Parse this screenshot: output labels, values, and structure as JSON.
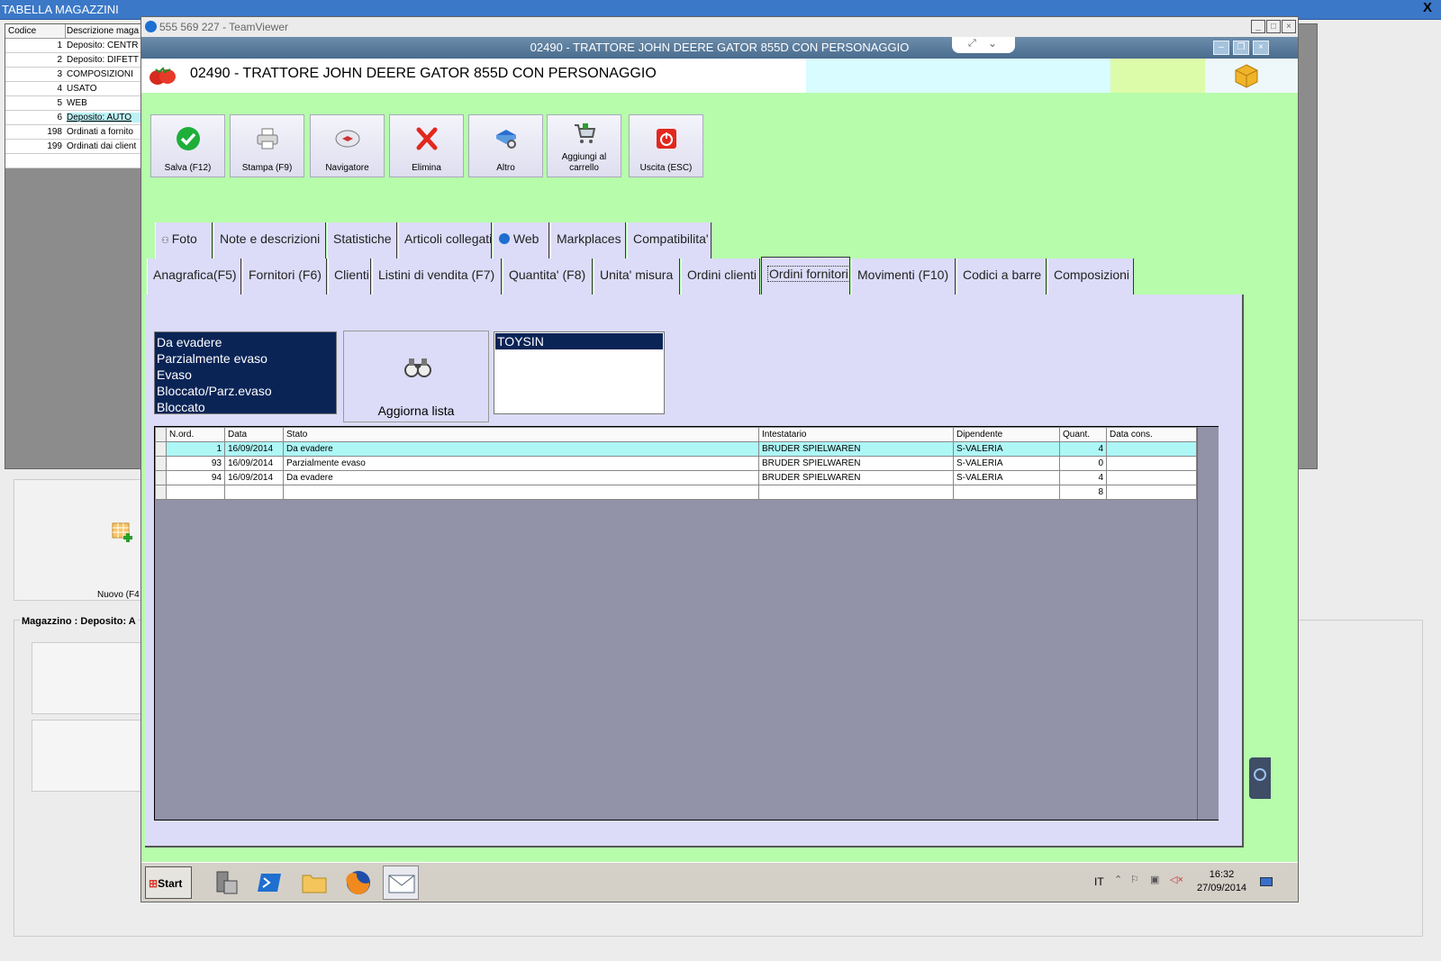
{
  "background_app": {
    "title": "TABELLA MAGAZZINI",
    "close_glyph": "X",
    "grid_headers": [
      "Codice",
      "Descrizione maga"
    ],
    "rows": [
      {
        "code": "1",
        "desc": "Deposito: CENTR"
      },
      {
        "code": "2",
        "desc": "Deposito: DIFETT"
      },
      {
        "code": "3",
        "desc": "COMPOSIZIONI"
      },
      {
        "code": "4",
        "desc": "USATO"
      },
      {
        "code": "5",
        "desc": "WEB"
      },
      {
        "code": "6",
        "desc": "Deposito: AUTO"
      },
      {
        "code": "198",
        "desc": "Ordinati a fornito"
      },
      {
        "code": "199",
        "desc": "Ordinati dai client"
      }
    ],
    "new_button": "Nuovo (F4",
    "magazzino_label": "Magazzino : Deposito: A"
  },
  "teamviewer": {
    "title": "555 569 227 - TeamViewer"
  },
  "remote_app": {
    "window_title": "02490 - TRATTORE JOHN DEERE GATOR 855D CON PERSONAGGIO",
    "header_title": "02490 - TRATTORE JOHN DEERE GATOR 855D CON PERSONAGGIO",
    "toolbar": {
      "save": "Salva (F12)",
      "print": "Stampa (F9)",
      "navigator": "Navigatore",
      "delete": "Elimina",
      "other": "Altro",
      "cart_line1": "Aggiungi al",
      "cart_line2": "carrello",
      "exit": "Uscita (ESC)"
    },
    "tabs_row1": [
      "Foto",
      "Note e descrizioni",
      "Statistiche",
      "Articoli collegati",
      "Web",
      "Markplaces",
      "Compatibilita'"
    ],
    "tabs_row2": [
      "Anagrafica(F5)",
      "Fornitori (F6)",
      "Clienti",
      "Listini di vendita (F7)",
      "Quantita' (F8)",
      "Unita' misura",
      "Ordini clienti",
      "Ordini fornitori",
      "Movimenti (F10)",
      "Codici a barre",
      "Composizioni"
    ],
    "active_tab": "Ordini fornitori",
    "stato_options": [
      "Da evadere",
      "Parzialmente evaso",
      "Evaso",
      "Bloccato/Parz.evaso",
      "Bloccato"
    ],
    "refresh_button": "Aggiorna lista",
    "supplier_selected": "TOYSIN",
    "orders": {
      "columns": [
        "N.ord.",
        "Data",
        "Stato",
        "Intestatario",
        "Dipendente",
        "Quant.",
        "Data cons."
      ],
      "rows": [
        {
          "n": "1",
          "data": "16/09/2014",
          "stato": "Da evadere",
          "intestatario": "BRUDER SPIELWAREN",
          "dipendente": "S-VALERIA",
          "quant": "4",
          "data_cons": ""
        },
        {
          "n": "93",
          "data": "16/09/2014",
          "stato": "Parzialmente evaso",
          "intestatario": "BRUDER SPIELWAREN",
          "dipendente": "S-VALERIA",
          "quant": "0",
          "data_cons": ""
        },
        {
          "n": "94",
          "data": "16/09/2014",
          "stato": "Da evadere",
          "intestatario": "BRUDER SPIELWAREN",
          "dipendente": "S-VALERIA",
          "quant": "4",
          "data_cons": ""
        }
      ],
      "total_quant": "8"
    },
    "taskbar": {
      "start": "Start",
      "lang": "IT",
      "time": "16:32",
      "date": "27/09/2014"
    }
  },
  "colors": {
    "app_bg": "#b6fcab",
    "panel_bg": "#dcdcf8",
    "selection_dark": "#0a2456",
    "grid_area": "#9292a8",
    "current_row": "#aef7f7"
  }
}
